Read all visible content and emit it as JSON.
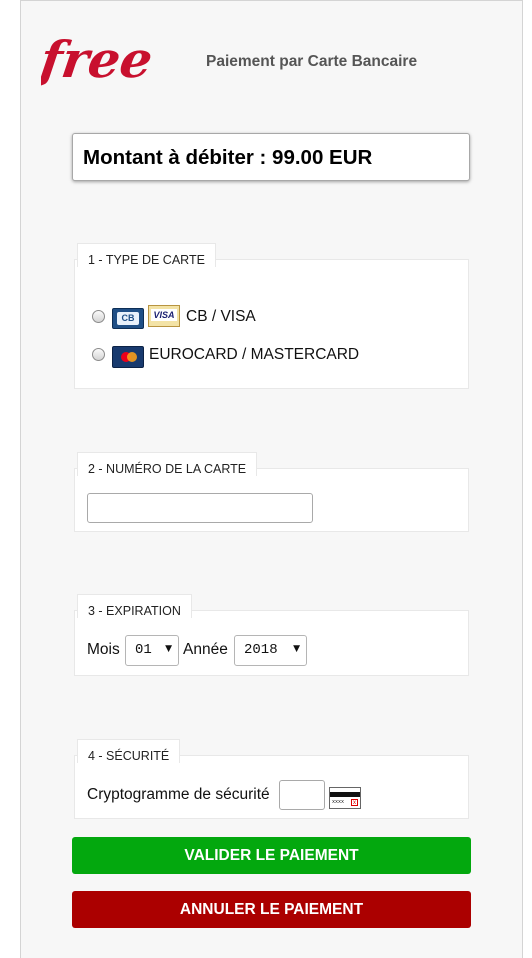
{
  "header": {
    "logo_text": "free",
    "title": "Paiement par Carte Bancaire"
  },
  "amount": "Montant à débiter : 99.00 EUR",
  "card_type": {
    "legend": "1 - TYPE DE CARTE",
    "options": [
      {
        "label": "CB / VISA",
        "logos": [
          "cb-icon",
          "visa-icon"
        ],
        "selected": false
      },
      {
        "label": "EUROCARD / MASTERCARD",
        "logos": [
          "mastercard-icon"
        ],
        "selected": false
      }
    ]
  },
  "card_number": {
    "legend": "2 - NUMÉRO DE LA CARTE",
    "value": ""
  },
  "expiration": {
    "legend": "3 - EXPIRATION",
    "month_label": "Mois",
    "month_value": "01",
    "year_label": "Année",
    "year_value": "2018"
  },
  "security": {
    "legend": "4 - SÉCURITÉ",
    "label": "Cryptogramme de sécurité",
    "value": ""
  },
  "buttons": {
    "validate": "VALIDER LE PAIEMENT",
    "cancel": "ANNULER LE PAIEMENT"
  },
  "colors": {
    "brand": "#c8102e",
    "validate": "#03a80e",
    "cancel": "#ab0000"
  }
}
